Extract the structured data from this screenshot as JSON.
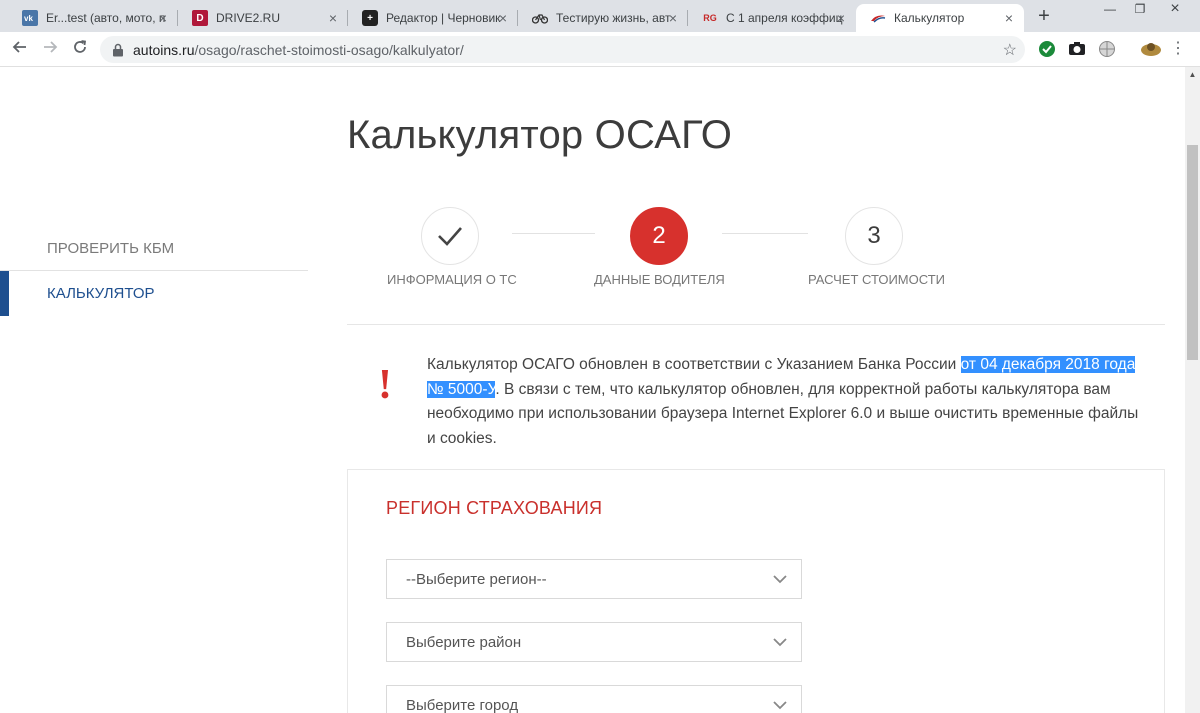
{
  "browser": {
    "tabs": [
      {
        "title": "Er...test (авто, мото, п",
        "favicon": "vk-icon",
        "color": "#4a76a8",
        "letter": "VK"
      },
      {
        "title": "DRIVE2.RU",
        "favicon": "drive2-icon",
        "color": "#b0183a",
        "letter": "D"
      },
      {
        "title": "Редактор | Черновик",
        "favicon": "editor-icon",
        "color": "#222222",
        "letter": "+"
      },
      {
        "title": "Тестирую жизнь, авт",
        "favicon": "bike-icon",
        "color": "#ffffff",
        "letter": ""
      },
      {
        "title": "С 1 апреля коэффиц",
        "favicon": "rg-icon",
        "color": "#ffffff",
        "letter": "RG"
      },
      {
        "title": "Калькулятор",
        "favicon": "autoins-icon",
        "color": "#ffffff",
        "letter": ""
      }
    ],
    "url_host": "autoins.ru",
    "url_path": "/osago/raschet-stoimosti-osago/kalkulyator/"
  },
  "page": {
    "title": "Калькулятор ОСАГО",
    "sidebar": {
      "items": [
        {
          "label": "ПРОВЕРИТЬ КБМ"
        },
        {
          "label": "КАЛЬКУЛЯТОР"
        }
      ]
    },
    "steps": [
      {
        "number": "",
        "label": "ИНФОРМАЦИЯ О ТС",
        "state": "done"
      },
      {
        "number": "2",
        "label": "ДАННЫЕ ВОДИТЕЛЯ",
        "state": "current"
      },
      {
        "number": "3",
        "label": "РАСЧЕТ СТОИМОСТИ",
        "state": "pending"
      }
    ],
    "notice": {
      "part1": "Калькулятор ОСАГО обновлен в соответствии с Указанием Банка России ",
      "highlight": "от 04 декабря 2018 года № 5000-У",
      "part2": ". В связи с тем, что калькулятор обновлен, для корректной работы калькулятора вам необходимо при использовании браузера Internet Explorer 6.0 и выше очистить временные файлы и cookies."
    },
    "region_section": {
      "title": "РЕГИОН СТРАХОВАНИЯ",
      "region_select": "--Выберите регион--",
      "district_select": "Выберите район",
      "city_select": "Выберите город"
    }
  },
  "colors": {
    "accent_red": "#d7312d",
    "sidebar_active": "#1e4f8f",
    "selection": "#3390ff"
  }
}
